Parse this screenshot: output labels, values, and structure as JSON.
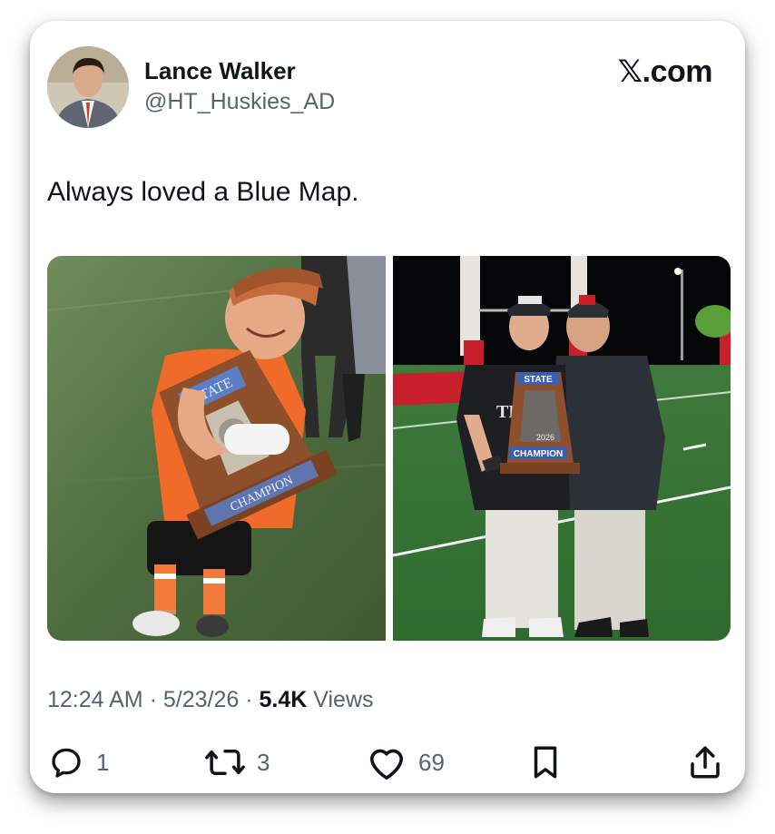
{
  "author": {
    "name": "Lance Walker",
    "handle": "@HT_Huskies_AD"
  },
  "brand": {
    "logo_glyph": "𝕏",
    "suffix": ".com"
  },
  "tweet": {
    "text": "Always loved a Blue Map."
  },
  "media": {
    "left_photo": {
      "trophy_top": "STATE",
      "trophy_bottom": "CHAMPION"
    },
    "right_photo": {
      "jersey_text": "TRISV",
      "trophy_top": "STATE",
      "trophy_year": "2026",
      "trophy_bottom": "CHAMPION"
    }
  },
  "meta": {
    "time": "12:24 AM",
    "sep1": " · ",
    "date": "5/23/26",
    "sep2": " · ",
    "views_count": "5.4K",
    "views_label": " Views"
  },
  "actions": {
    "reply": {
      "icon": "reply-icon",
      "count": "1"
    },
    "retweet": {
      "icon": "retweet-icon",
      "count": "3"
    },
    "like": {
      "icon": "heart-icon",
      "count": "69"
    },
    "bookmark": {
      "icon": "bookmark-icon"
    },
    "share": {
      "icon": "share-icon"
    }
  },
  "colors": {
    "text_primary": "#0f1419",
    "text_secondary": "#536471",
    "turf": "#4b6b3c",
    "jersey_orange": "#f06a2a"
  }
}
